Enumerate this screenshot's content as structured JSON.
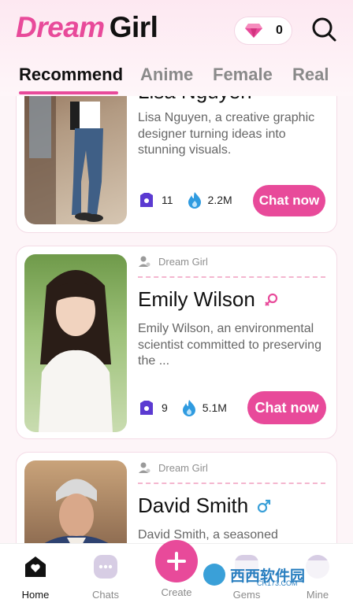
{
  "app": {
    "logo_word_1": "Dream",
    "logo_word_2": "Girl",
    "gems_count": "0"
  },
  "tabs": [
    {
      "label": "Recommend",
      "active": true
    },
    {
      "label": "Anime",
      "active": false
    },
    {
      "label": "Female",
      "active": false
    },
    {
      "label": "Real",
      "active": false
    }
  ],
  "cards": [
    {
      "name": "Lisa Nguyen",
      "description": "Lisa Nguyen, a creative graphic designer turning ideas into stunning visuals.",
      "count": "11",
      "popularity": "2.2M",
      "cta": "Chat now",
      "gender": "female",
      "image_icon": "woman-in-jeans-photo"
    },
    {
      "creator": "Dream Girl",
      "name": "Emily Wilson",
      "description": "Emily Wilson, an environmental scientist committed to preserving the ...",
      "count": "9",
      "popularity": "5.1M",
      "cta": "Chat now",
      "gender": "female",
      "image_icon": "woman-in-white-sweater-photo"
    },
    {
      "creator": "Dream Girl",
      "name": "David Smith",
      "description": "David Smith, a seasoned",
      "gender": "male",
      "image_icon": "man-in-suit-photo"
    }
  ],
  "bottom_nav": [
    {
      "label": "Home",
      "active": true
    },
    {
      "label": "Chats",
      "active": false
    },
    {
      "label": "Create",
      "active": false
    },
    {
      "label": "Gems",
      "active": false
    },
    {
      "label": "Mine",
      "active": false
    }
  ],
  "watermark": {
    "text": "西西软件园",
    "sub": "CR173.COM"
  },
  "colors": {
    "accent": "#e84a9a",
    "female_symbol": "#e84a9a",
    "male_symbol": "#3aa0d8",
    "tag_icon": "#5b3ad1",
    "fire_icon": "#2f9be0"
  }
}
